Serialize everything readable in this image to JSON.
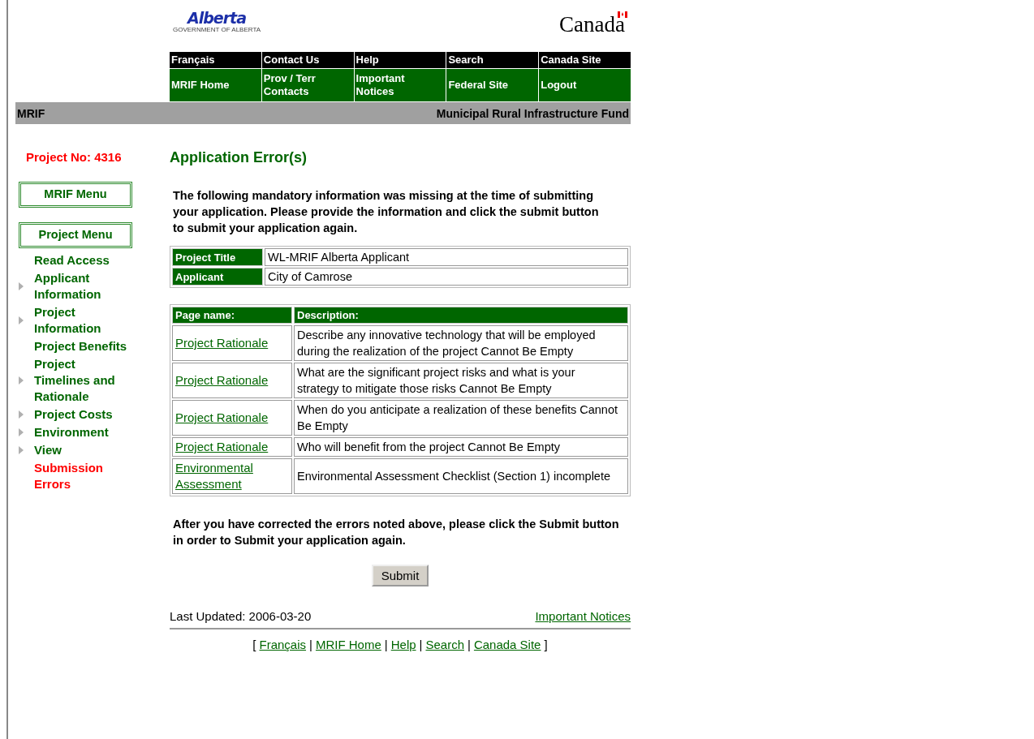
{
  "header": {
    "left_logo": {
      "name": "Alberta",
      "subtitle": "GOVERNMENT OF ALBERTA"
    },
    "right_logo": {
      "name": "Canada"
    }
  },
  "nav": {
    "top_row": [
      "Français",
      "Contact Us",
      "Help",
      "Search",
      "Canada Site"
    ],
    "bottom_row": [
      "MRIF Home",
      "Prov / Terr Contacts",
      "Important Notices",
      "Federal Site",
      "Logout"
    ]
  },
  "title_bar": {
    "left": "MRIF",
    "right": "Municipal Rural Infrastructure Fund"
  },
  "sidebar": {
    "project_no": "Project No:  4316",
    "menus": [
      "MRIF Menu",
      "Project Menu"
    ],
    "items": [
      {
        "label": "Read Access",
        "expandable": false,
        "selected": false
      },
      {
        "label": "Applicant Information",
        "expandable": true,
        "selected": false
      },
      {
        "label": "Project Information",
        "expandable": true,
        "selected": false
      },
      {
        "label": "Project Benefits",
        "expandable": false,
        "selected": false
      },
      {
        "label": "Project Timelines and Rationale",
        "expandable": true,
        "selected": false
      },
      {
        "label": "Project Costs",
        "expandable": true,
        "selected": false
      },
      {
        "label": "Environment",
        "expandable": true,
        "selected": false
      },
      {
        "label": "View",
        "expandable": true,
        "selected": false
      },
      {
        "label": "Submission Errors",
        "expandable": false,
        "selected": true
      }
    ]
  },
  "main": {
    "heading": "Application Error(s)",
    "intro": "The following mandatory information was missing at the time of submitting your application. Please provide the information and click the submit button to submit your application again.",
    "info": [
      {
        "label": "Project Title",
        "value": "WL-MRIF Alberta Applicant"
      },
      {
        "label": "Applicant",
        "value": "City of Camrose"
      }
    ],
    "errors": {
      "columns": [
        "Page name:",
        "Description:"
      ],
      "rows": [
        {
          "page": "Project Rationale",
          "description": "Describe any innovative technology that will be employed during the realization of the project Cannot Be Empty"
        },
        {
          "page": "Project Rationale",
          "description": "What are the significant project risks and what is your strategy to mitigate those risks Cannot Be Empty"
        },
        {
          "page": "Project Rationale",
          "description": "When do you anticipate a realization of these benefits Cannot Be Empty"
        },
        {
          "page": "Project Rationale",
          "description": "Who will benefit from the project Cannot Be Empty"
        },
        {
          "page": "Environmental Assessment",
          "description": "Environmental Assessment Checklist (Section 1) incomplete"
        }
      ]
    },
    "outro": "After you have corrected the errors noted above, please click the Submit button in order to Submit your application again.",
    "submit": "Submit"
  },
  "footer": {
    "last_updated": "Last Updated: 2006-03-20",
    "notices_link": "Important Notices",
    "bracket_open": "[",
    "bracket_close": "]",
    "links": [
      "Français",
      "MRIF Home",
      "Help",
      "Search",
      "Canada Site"
    ],
    "separator": "|"
  }
}
